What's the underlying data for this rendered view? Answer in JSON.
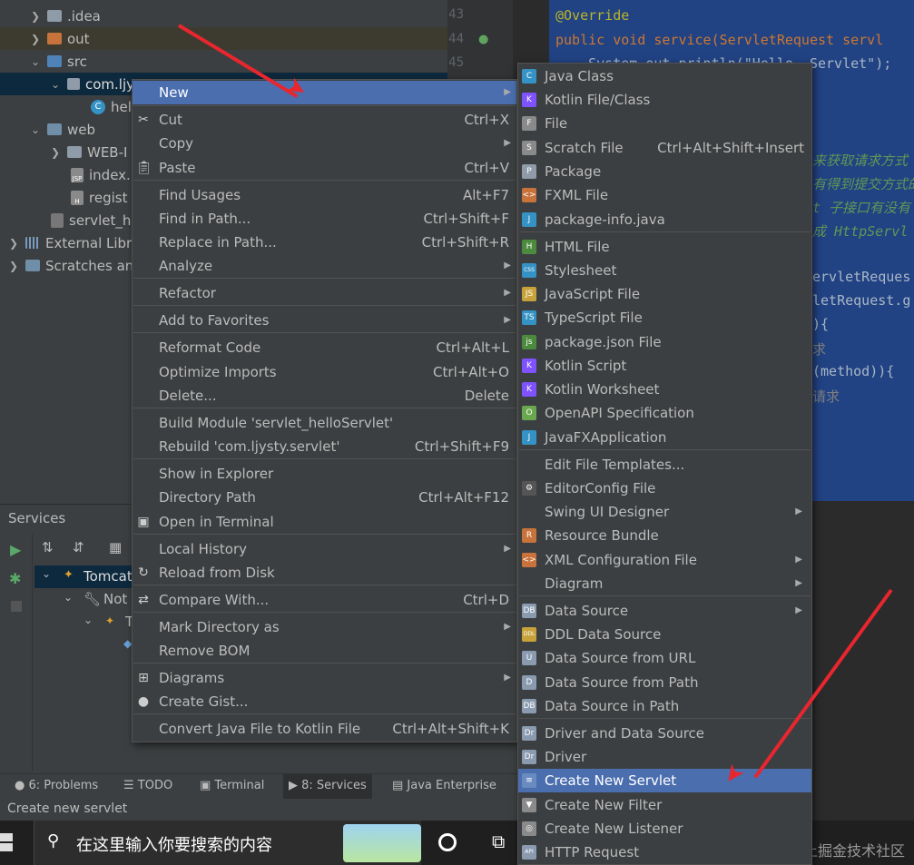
{
  "tree": {
    "items": [
      ".idea",
      "out",
      "src",
      "com.ljy",
      "hel",
      "web",
      "WEB-I",
      "index.",
      "regist",
      "servlet_h",
      "External Libr",
      "Scratches an"
    ]
  },
  "gutter": {
    "lines": [
      "43",
      "44",
      "45"
    ]
  },
  "editor": {
    "line1": "@Override",
    "line2": "public void service(ServletRequest servl",
    "line3": "    System.out.println(\"Hello, Servlet\");",
    "c1": "来获取请求方式",
    "c2": "有得到提交方式的",
    "c3": "t 子接口有没有",
    "c4": "成 HttpServl",
    "c5": "ervletReques",
    "c6": "letRequest.g",
    "c7": "){",
    "c8": "求",
    "c9": "(method)){",
    "c10": "请求"
  },
  "services": {
    "title": "Services",
    "tree": [
      "Tomcat",
      "Not",
      "T"
    ]
  },
  "bottom_tabs": [
    "6: Problems",
    "TODO",
    "Terminal",
    "8: Services",
    "Java Enterprise"
  ],
  "status": "Create new servlet",
  "taskbar": {
    "search_placeholder": "在这里输入你要搜索的内容"
  },
  "watermark": "@稀土掘金技术社区",
  "menu1": [
    {
      "label": "New",
      "shortcut": "",
      "sub": true,
      "hl": true
    },
    {
      "label": "Cut",
      "shortcut": "Ctrl+X",
      "icon": "scissors-icon"
    },
    {
      "label": "Copy",
      "shortcut": "",
      "sub": true
    },
    {
      "label": "Paste",
      "shortcut": "Ctrl+V",
      "icon": "clipboard-icon"
    },
    {
      "label": "Find Usages",
      "shortcut": "Alt+F7"
    },
    {
      "label": "Find in Path...",
      "shortcut": "Ctrl+Shift+F"
    },
    {
      "label": "Replace in Path...",
      "shortcut": "Ctrl+Shift+R"
    },
    {
      "label": "Analyze",
      "shortcut": "",
      "sub": true
    },
    {
      "label": "Refactor",
      "shortcut": "",
      "sub": true
    },
    {
      "label": "Add to Favorites",
      "shortcut": "",
      "sub": true
    },
    {
      "label": "Reformat Code",
      "shortcut": "Ctrl+Alt+L"
    },
    {
      "label": "Optimize Imports",
      "shortcut": "Ctrl+Alt+O"
    },
    {
      "label": "Delete...",
      "shortcut": "Delete"
    },
    {
      "label": "Build Module 'servlet_helloServlet'",
      "shortcut": ""
    },
    {
      "label": "Rebuild 'com.ljysty.servlet'",
      "shortcut": "Ctrl+Shift+F9"
    },
    {
      "label": "Show in Explorer",
      "shortcut": ""
    },
    {
      "label": "Directory Path",
      "shortcut": "Ctrl+Alt+F12"
    },
    {
      "label": "Open in Terminal",
      "shortcut": "",
      "icon": "terminal-icon"
    },
    {
      "label": "Local History",
      "shortcut": "",
      "sub": true
    },
    {
      "label": "Reload from Disk",
      "shortcut": "",
      "icon": "reload-icon"
    },
    {
      "label": "Compare With...",
      "shortcut": "Ctrl+D",
      "icon": "compare-icon"
    },
    {
      "label": "Mark Directory as",
      "shortcut": "",
      "sub": true
    },
    {
      "label": "Remove BOM",
      "shortcut": ""
    },
    {
      "label": "Diagrams",
      "shortcut": "",
      "sub": true,
      "icon": "diagram-icon"
    },
    {
      "label": "Create Gist...",
      "shortcut": "",
      "icon": "github-icon"
    },
    {
      "label": "Convert Java File to Kotlin File",
      "shortcut": "Ctrl+Alt+Shift+K"
    }
  ],
  "menu2": [
    {
      "label": "Java Class",
      "icon": "C",
      "color": "#3592c4"
    },
    {
      "label": "Kotlin File/Class",
      "icon": "K",
      "color": "#7f52ff"
    },
    {
      "label": "File",
      "icon": "F",
      "color": "#8a8a8a"
    },
    {
      "label": "Scratch File",
      "shortcut": "Ctrl+Alt+Shift+Insert",
      "icon": "S",
      "color": "#8a8a8a"
    },
    {
      "label": "Package",
      "icon": "P",
      "color": "#8f9ba8"
    },
    {
      "label": "FXML File",
      "icon": "<>",
      "color": "#c7733b"
    },
    {
      "label": "package-info.java",
      "icon": "J",
      "color": "#3592c4"
    },
    {
      "label": "HTML File",
      "icon": "H",
      "color": "#4c8a3e"
    },
    {
      "label": "Stylesheet",
      "icon": "CSS",
      "color": "#3592c4"
    },
    {
      "label": "JavaScript File",
      "icon": "JS",
      "color": "#c7a23b"
    },
    {
      "label": "TypeScript File",
      "icon": "TS",
      "color": "#3592c4"
    },
    {
      "label": "package.json File",
      "icon": "js",
      "color": "#4c8a3e"
    },
    {
      "label": "Kotlin Script",
      "icon": "K",
      "color": "#7f52ff"
    },
    {
      "label": "Kotlin Worksheet",
      "icon": "K",
      "color": "#7f52ff"
    },
    {
      "label": "OpenAPI Specification",
      "icon": "O",
      "color": "#6aa84f"
    },
    {
      "label": "JavaFXApplication",
      "icon": "J",
      "color": "#3592c4"
    },
    {
      "label": "Edit File Templates...",
      "icon": "",
      "color": ""
    },
    {
      "label": "EditorConfig File",
      "icon": "⚙",
      "color": "#555"
    },
    {
      "label": "Swing UI Designer",
      "sub": true,
      "icon": "",
      "color": ""
    },
    {
      "label": "Resource Bundle",
      "icon": "R",
      "color": "#c7733b"
    },
    {
      "label": "XML Configuration File",
      "sub": true,
      "icon": "<>",
      "color": "#c7733b"
    },
    {
      "label": "Diagram",
      "sub": true,
      "icon": "",
      "color": ""
    },
    {
      "label": "Data Source",
      "sub": true,
      "icon": "DB",
      "color": "#8a9bb0"
    },
    {
      "label": "DDL Data Source",
      "icon": "DDL",
      "color": "#c7a23b"
    },
    {
      "label": "Data Source from URL",
      "icon": "U",
      "color": "#8a9bb0"
    },
    {
      "label": "Data Source from Path",
      "icon": "D",
      "color": "#8a9bb0"
    },
    {
      "label": "Data Source in Path",
      "icon": "DB",
      "color": "#8a9bb0"
    },
    {
      "label": "Driver and Data Source",
      "icon": "Dr",
      "color": "#8a9bb0"
    },
    {
      "label": "Driver",
      "icon": "Dr",
      "color": "#8a9bb0"
    },
    {
      "label": "Create New Servlet",
      "hl": true,
      "icon": "≡",
      "color": "#6a8bbf"
    },
    {
      "label": "Create New Filter",
      "icon": "▼",
      "color": "#8a8a8a"
    },
    {
      "label": "Create New Listener",
      "icon": "◎",
      "color": "#8a8a8a"
    },
    {
      "label": "HTTP Request",
      "icon": "API",
      "color": "#8a9bb0"
    }
  ]
}
